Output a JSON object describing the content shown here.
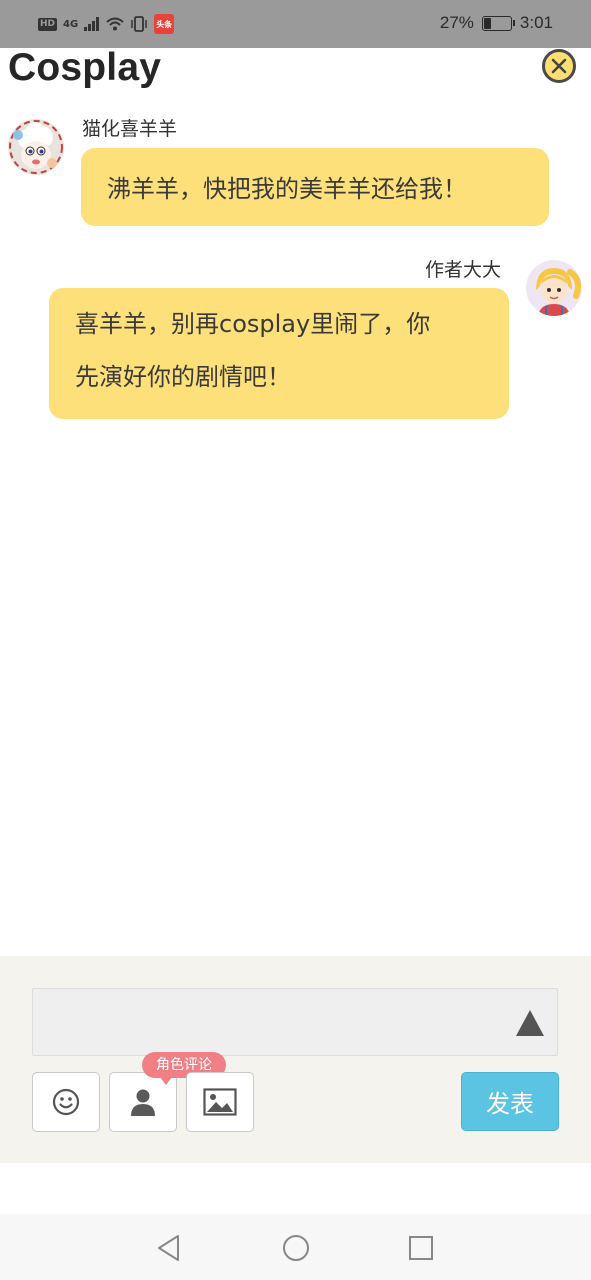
{
  "status_bar": {
    "network_hd": "HD",
    "network_type": "4G",
    "app_badge": "头条",
    "battery_text": "27%",
    "battery_level": 0.27,
    "time": "3:01"
  },
  "header": {
    "title": "Cosplay",
    "close_icon": "close-circle-icon"
  },
  "messages": [
    {
      "sender": "猫化喜羊羊",
      "text": "沸羊羊，快把我的美羊羊还给我！",
      "side": "left"
    },
    {
      "sender": "作者大大",
      "text_line1": "喜羊羊，别再cosplay里闹了，你",
      "text_line2": "先演好你的剧情吧！",
      "side": "right"
    }
  ],
  "composer": {
    "input_value": "",
    "expand_icon": "triangle-up-icon",
    "tools": [
      "emoji-icon",
      "role-icon",
      "image-icon"
    ],
    "role_badge": "角色评论",
    "send_label": "发表"
  },
  "colors": {
    "bubble": "#fde07a",
    "close_button": "#ffdf73",
    "send_button": "#5bc4e3",
    "badge": "#f07f86",
    "composer_bg": "#f4f3ee"
  }
}
